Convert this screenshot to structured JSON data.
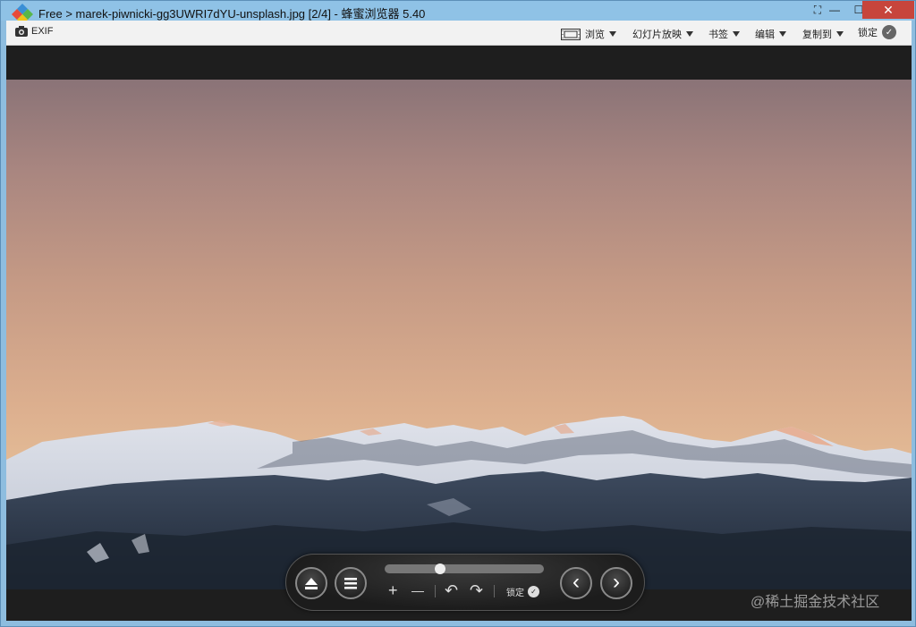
{
  "window": {
    "title": "Free > marek-piwnicki-gg3UWRI7dYU-unsplash.jpg [2/4] - 蜂蜜浏览器 5.40",
    "close_glyph": "✕",
    "max_glyph": "☐",
    "min_glyph": "—",
    "fullscreen_glyph": "⛶"
  },
  "toolbar": {
    "exif_label": "EXIF",
    "browse_label": "浏览",
    "slideshow_label": "幻灯片放映",
    "bookmark_label": "书签",
    "edit_label": "编辑",
    "copyto_label": "复制到",
    "lock_label": "锁定"
  },
  "controls": {
    "lock_label": "锁定",
    "zoom_in_glyph": "+",
    "zoom_out_glyph": "—",
    "rotate_left_glyph": "↶",
    "rotate_right_glyph": "↷",
    "prev_glyph": "‹",
    "next_glyph": "›",
    "position_fraction": 0.34
  },
  "watermark": "@稀土掘金技术社区",
  "colors": {
    "titlebar": "#8fc2e6",
    "close_button": "#c7453c",
    "toolbar": "#f2f2f2",
    "viewer_bg": "#1e1e1e"
  }
}
